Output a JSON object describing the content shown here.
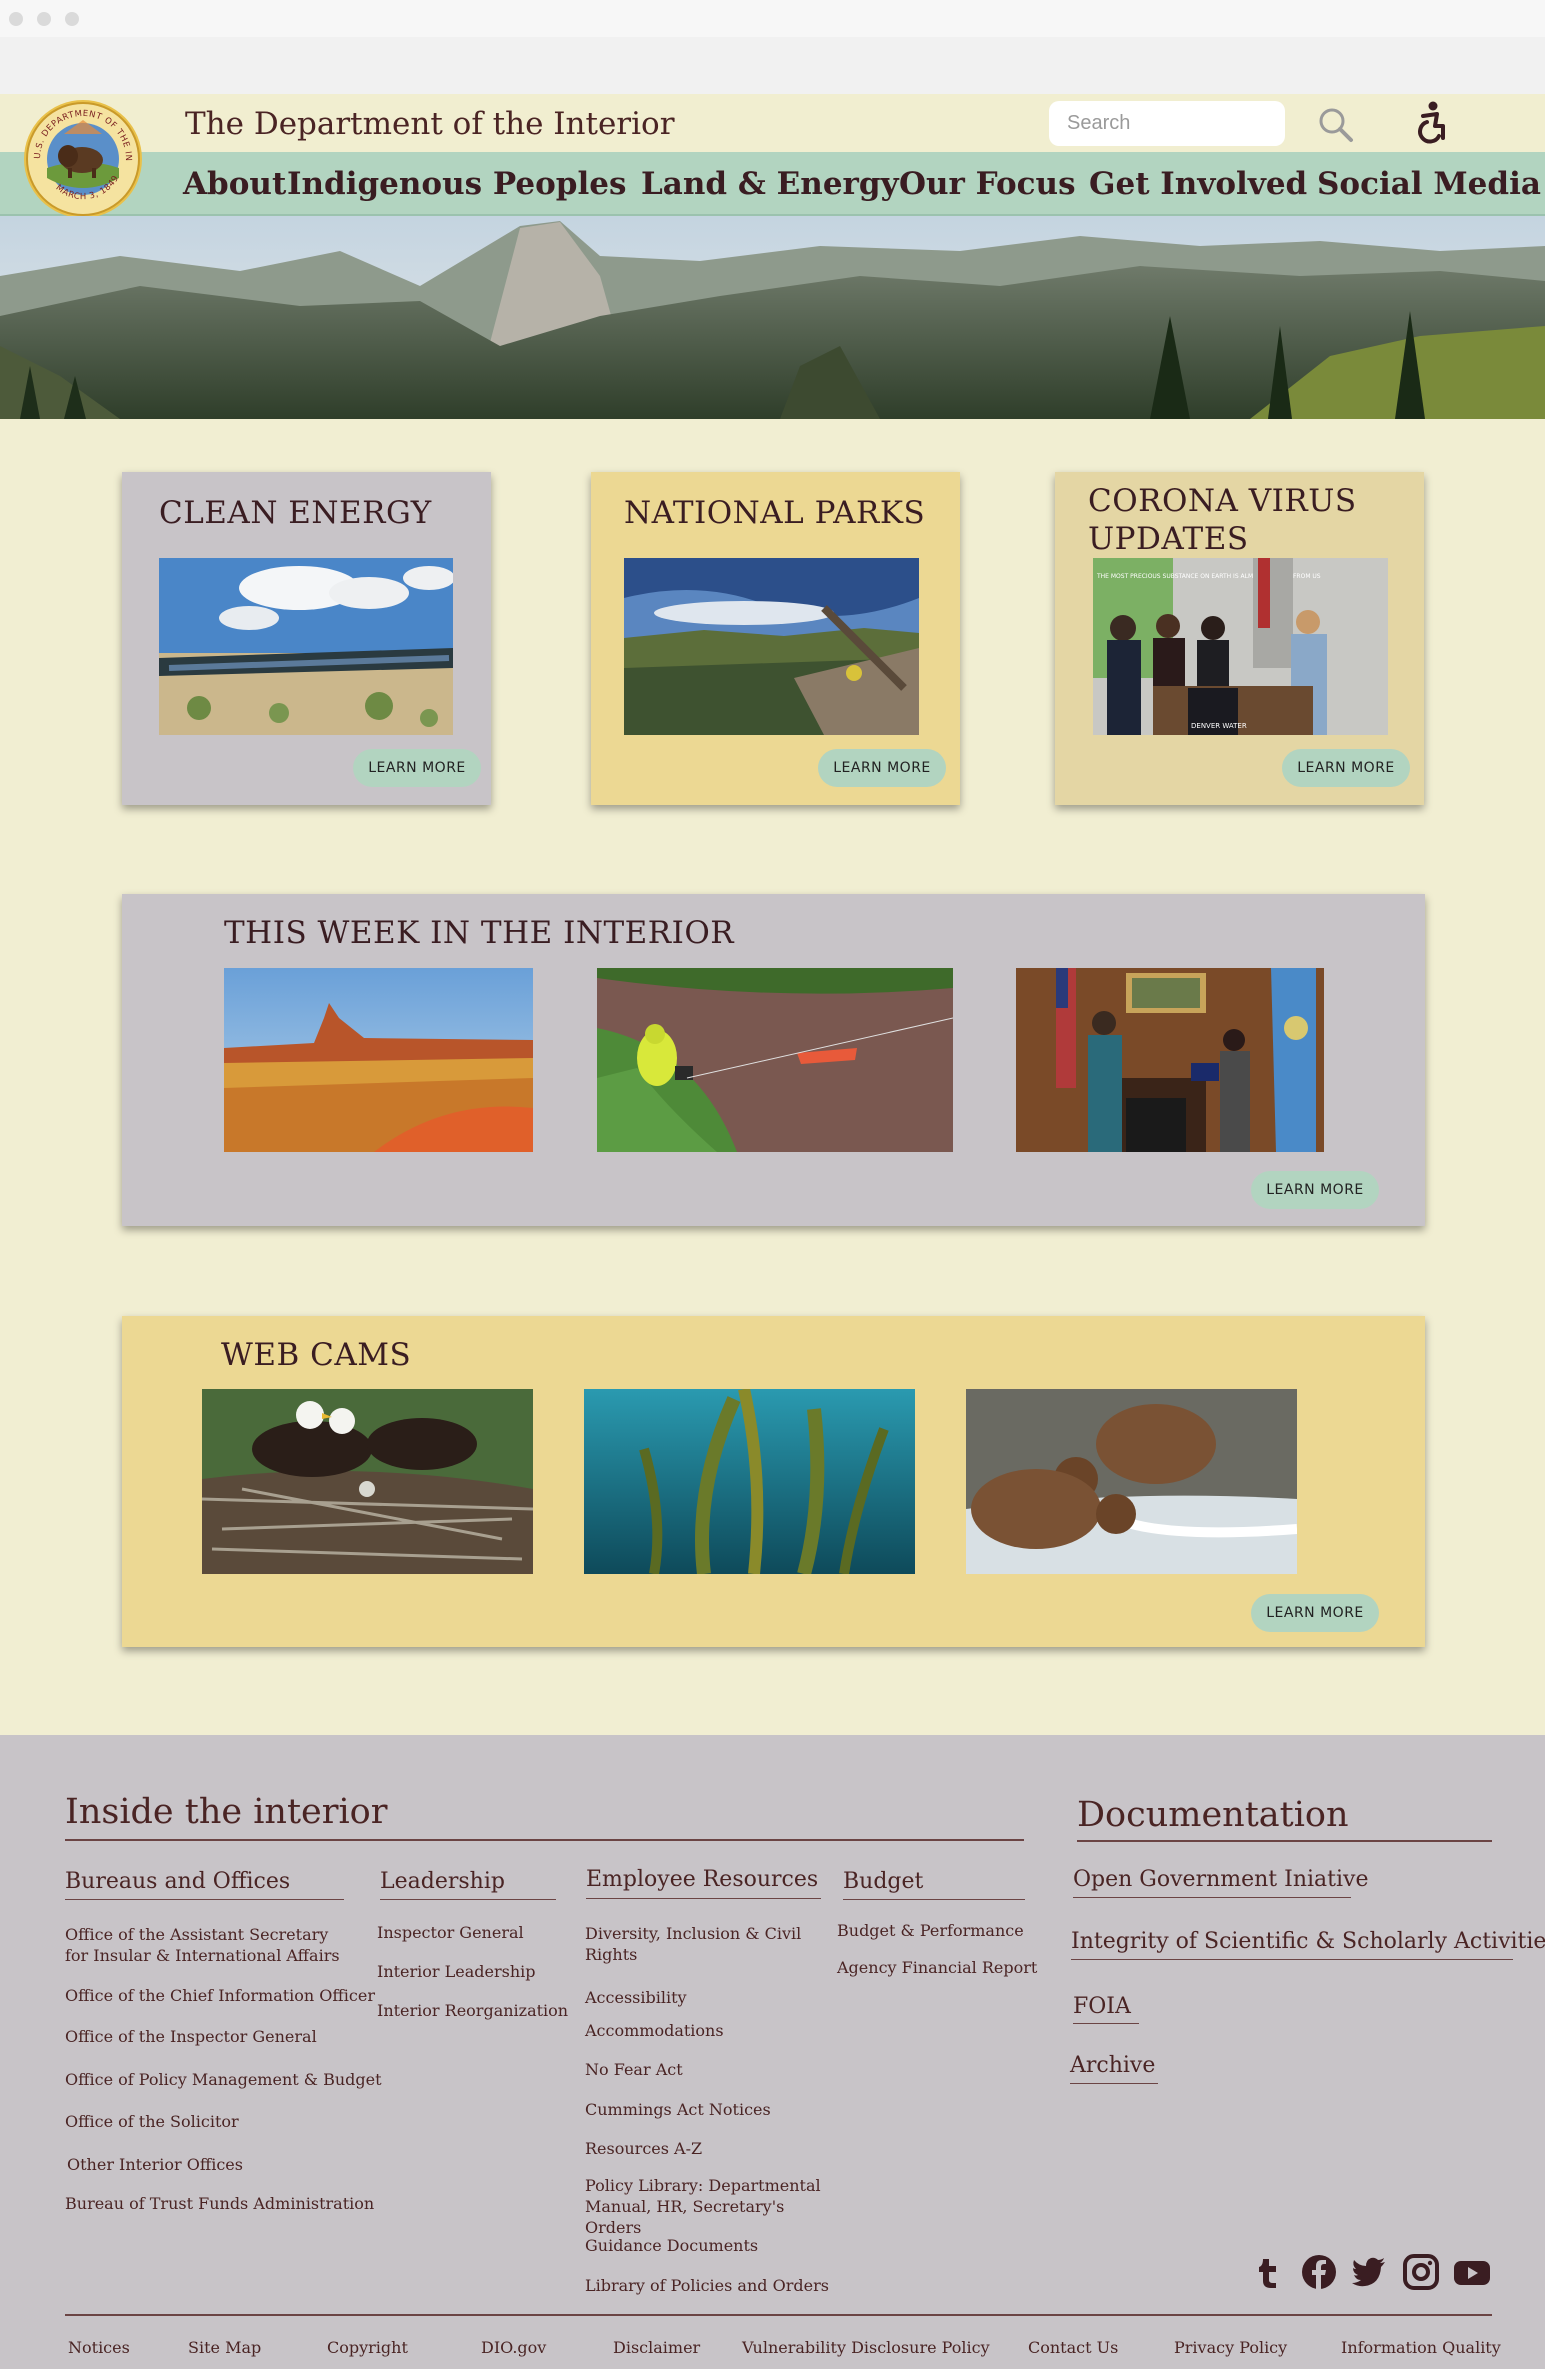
{
  "header": {
    "title": "The Department of the Interior",
    "search_placeholder": "Search",
    "seal_text_top": "U.S. DEPARTMENT OF THE INTERIOR",
    "seal_text_bottom": "MARCH 3, 1849"
  },
  "nav": {
    "items": [
      {
        "label": "About"
      },
      {
        "label": "Indigenous Peoples"
      },
      {
        "label": "Land & Energy"
      },
      {
        "label": "Our Focus"
      },
      {
        "label": "Get Involved"
      },
      {
        "label": "Social Media"
      }
    ]
  },
  "cards": [
    {
      "title": "CLEAN ENERGY",
      "button": "LEARN MORE"
    },
    {
      "title": "NATIONAL PARKS",
      "button": "LEARN MORE"
    },
    {
      "title": "CORONA VIRUS UPDATES",
      "button": "LEARN MORE",
      "photo_caption": "DENVER WATER",
      "banner_text": "THE MOST PRECIOUS SUBSTANCE ON EARTH IS ALMOST HIDDEN FROM US"
    }
  ],
  "week": {
    "title": "THIS WEEK IN THE INTERIOR",
    "button": "LEARN MORE"
  },
  "webcams": {
    "title": "WEB CAMS",
    "button": "LEARN MORE"
  },
  "colors": {
    "page_bg": "#f1eed2",
    "nav_bg": "#b2d4c0",
    "card_gray": "#c8c4c8",
    "card_yellow": "#ecd893",
    "card_tan": "#e4d6a4",
    "text": "#4a2424",
    "footer_bg": "#c8c4c8"
  },
  "footer": {
    "inside_title": "Inside the interior",
    "documentation_title": "Documentation",
    "columns": [
      {
        "heading": "Bureaus and Offices",
        "links": [
          "Office of the Assistant Secretary for Insular & International Affairs",
          "Office of the Chief Information Officer",
          "Office of the Inspector General",
          "Office of Policy Management & Budget",
          "Office of the Solicitor",
          "Other Interior Offices",
          "Bureau of Trust Funds Administration"
        ]
      },
      {
        "heading": "Leadership",
        "links": [
          "Inspector General",
          "Interior Leadership",
          "Interior Reorganization"
        ]
      },
      {
        "heading": "Employee Resources",
        "links": [
          "Diversity, Inclusion & Civil Rights",
          "Accessibility",
          "Accommodations",
          "No Fear Act",
          "Cummings Act Notices",
          "Resources A-Z",
          "Policy Library: Departmental Manual, HR, Secretary's Orders",
          "Guidance Documents",
          "Library of Policies and Orders"
        ]
      },
      {
        "heading": "Budget",
        "links": [
          "Budget & Performance",
          "Agency Financial Report"
        ]
      }
    ],
    "documentation": [
      "Open Government Iniative",
      "Integrity of Scientific & Scholarly Activities",
      "FOIA",
      "Archive"
    ],
    "social_icons": [
      "tumblr-icon",
      "facebook-icon",
      "twitter-icon",
      "instagram-icon",
      "youtube-icon"
    ],
    "bottom_links": [
      "Notices",
      "Site Map",
      "Copyright",
      "DIO.gov",
      "Disclaimer",
      "Vulnerability Disclosure Policy",
      "Contact Us",
      "Privacy Policy",
      "Information Quality"
    ]
  }
}
